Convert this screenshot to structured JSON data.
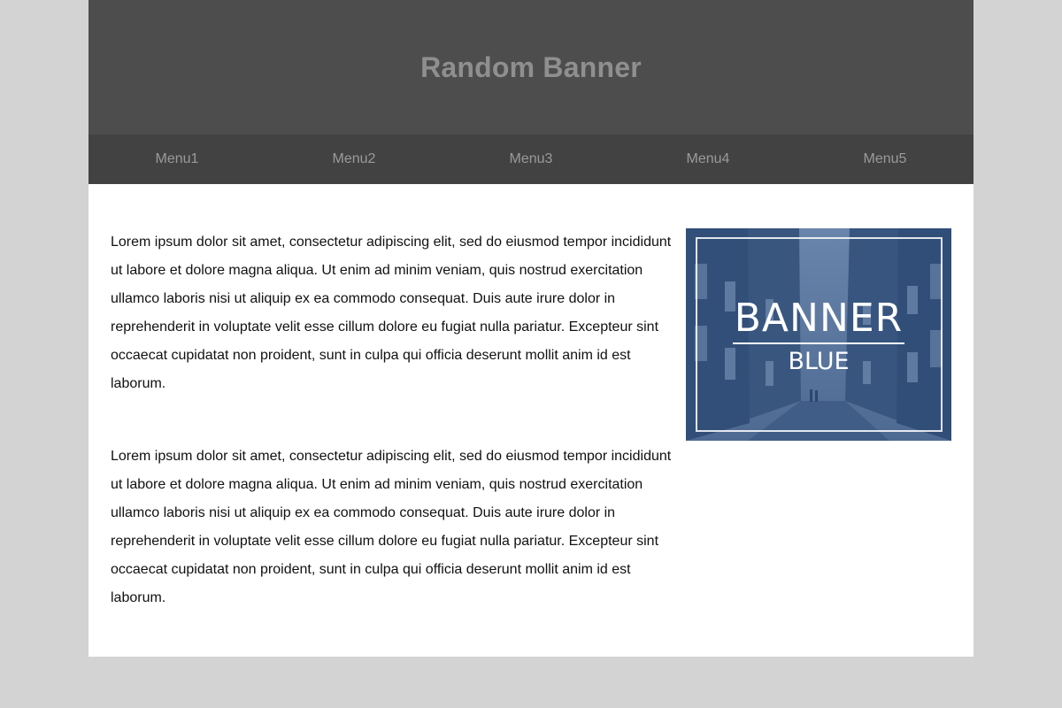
{
  "header": {
    "title": "Random Banner"
  },
  "nav": {
    "items": [
      {
        "label": "Menu1"
      },
      {
        "label": "Menu2"
      },
      {
        "label": "Menu3"
      },
      {
        "label": "Menu4"
      },
      {
        "label": "Menu5"
      }
    ]
  },
  "main": {
    "paragraphs": [
      "Lorem ipsum dolor sit amet, consectetur adipiscing elit, sed do eiusmod tempor incididunt ut labore et dolore magna aliqua. Ut enim ad minim veniam, quis nostrud exercitation ullamco laboris nisi ut aliquip ex ea commodo consequat. Duis aute irure dolor in reprehenderit in voluptate velit esse cillum dolore eu fugiat nulla pariatur. Excepteur sint occaecat cupidatat non proident, sunt in culpa qui officia deserunt mollit anim id est laborum.",
      "Lorem ipsum dolor sit amet, consectetur adipiscing elit, sed do eiusmod tempor incididunt ut labore et dolore magna aliqua. Ut enim ad minim veniam, quis nostrud exercitation ullamco laboris nisi ut aliquip ex ea commodo consequat. Duis aute irure dolor in reprehenderit in voluptate velit esse cillum dolore eu fugiat nulla pariatur. Excepteur sint occaecat cupidatat non proident, sunt in culpa qui officia deserunt mollit anim id est laborum."
    ]
  },
  "sidebar_ad": {
    "main_word": "BANNER",
    "sub_word": "BLUE"
  },
  "colors": {
    "page_background": "#d3d3d3",
    "banner_background": "#4d4d4d",
    "nav_background": "#424242",
    "banner_text": "#8f8f8f",
    "nav_text": "#9a9a9a",
    "ad_tint": "#3e5a80"
  }
}
